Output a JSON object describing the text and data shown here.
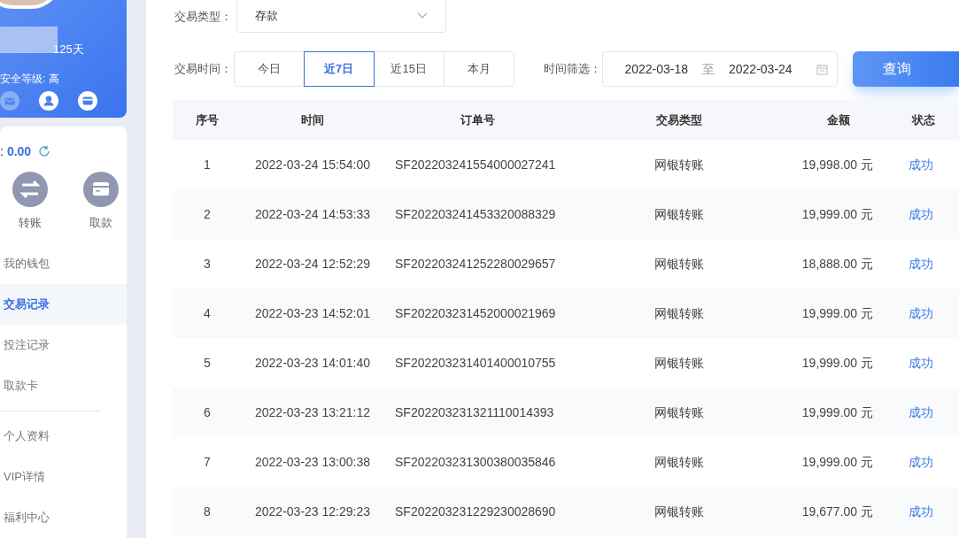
{
  "profile": {
    "days": "125天",
    "security": "安全等级: 高",
    "icons": [
      {
        "kind": "mail",
        "enabled": false
      },
      {
        "kind": "user",
        "enabled": true
      },
      {
        "kind": "card",
        "enabled": true
      }
    ]
  },
  "wallet": {
    "label": ":",
    "balance": "0.00",
    "actions": [
      {
        "kind": "transfer",
        "label": "转账"
      },
      {
        "kind": "withdraw",
        "label": "取款"
      }
    ]
  },
  "menu": [
    [
      {
        "label": "我的钱包",
        "selected": false
      },
      {
        "label": "交易记录",
        "selected": true
      },
      {
        "label": "投注记录",
        "selected": false
      },
      {
        "label": "取款卡",
        "selected": false
      }
    ],
    [
      {
        "label": "个人资料",
        "selected": false
      },
      {
        "label": "VIP详情",
        "selected": false
      },
      {
        "label": "福利中心",
        "selected": false
      }
    ]
  ],
  "filters": {
    "type_label": "交易类型：",
    "type_value": "存款",
    "time_label": "交易时间：",
    "ranges": [
      {
        "label": "今日",
        "selected": false
      },
      {
        "label": "近7日",
        "selected": true
      },
      {
        "label": "近15日",
        "selected": false
      },
      {
        "label": "本月",
        "selected": false
      }
    ],
    "date_label": "时间筛选：",
    "date_from": "2022-03-18",
    "date_sep": "至",
    "date_to": "2022-03-24",
    "query_button": "查询"
  },
  "table": {
    "columns": [
      "序号",
      "时间",
      "订单号",
      "交易类型",
      "金额",
      "状态"
    ],
    "rows": [
      [
        "1",
        "2022-03-24 15:54:00",
        "SF202203241554000027241",
        "网银转账",
        "19,998.00 元",
        "成功"
      ],
      [
        "2",
        "2022-03-24 14:53:33",
        "SF202203241453320088329",
        "网银转账",
        "19,999.00 元",
        "成功"
      ],
      [
        "3",
        "2022-03-24 12:52:29",
        "SF202203241252280029657",
        "网银转账",
        "18,888.00 元",
        "成功"
      ],
      [
        "4",
        "2022-03-23 14:52:01",
        "SF202203231452000021969",
        "网银转账",
        "19,999.00 元",
        "成功"
      ],
      [
        "5",
        "2022-03-23 14:01:40",
        "SF202203231401400010755",
        "网银转账",
        "19,999.00 元",
        "成功"
      ],
      [
        "6",
        "2022-03-23 13:21:12",
        "SF202203231321110014393",
        "网银转账",
        "19,999.00 元",
        "成功"
      ],
      [
        "7",
        "2022-03-23 13:00:38",
        "SF202203231300380035846",
        "网银转账",
        "19,999.00 元",
        "成功"
      ],
      [
        "8",
        "2022-03-23 12:29:23",
        "SF202203231229230028690",
        "网银转账",
        "19,677.00 元",
        "成功"
      ]
    ]
  }
}
